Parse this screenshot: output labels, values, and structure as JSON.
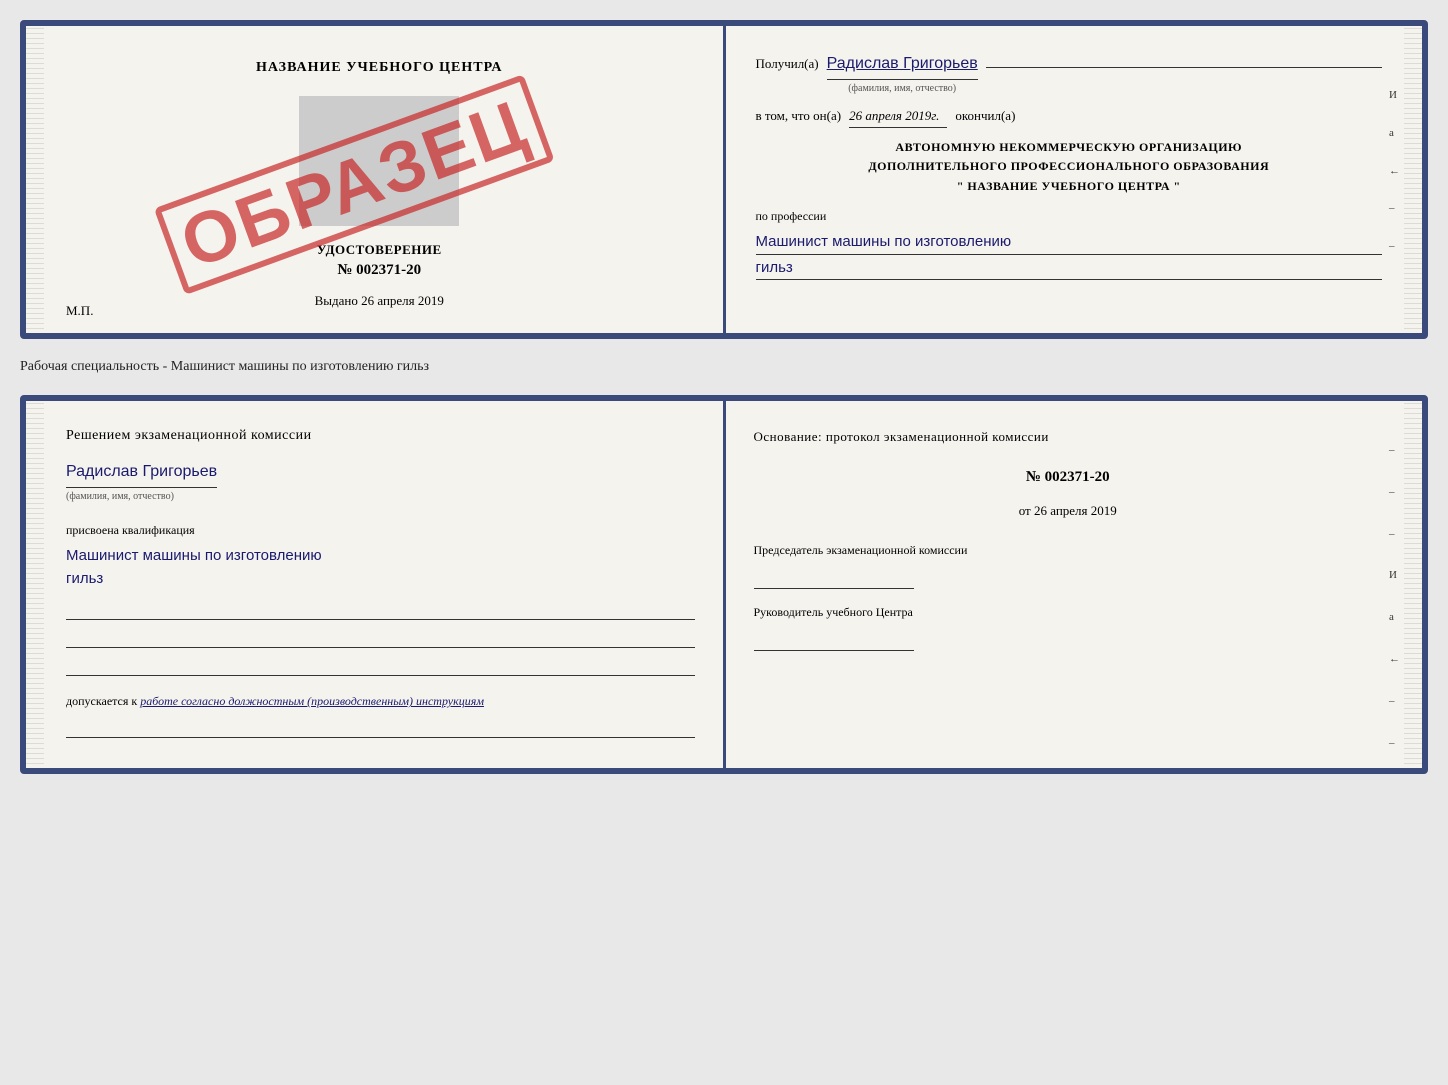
{
  "top_doc": {
    "left": {
      "center_title": "НАЗВАНИЕ УЧЕБНОГО ЦЕНТРА",
      "stamp_placeholder": "",
      "cert_title": "УДОСТОВЕРЕНИЕ",
      "cert_number": "№ 002371-20",
      "cert_date_label": "Выдано",
      "cert_date": "26 апреля 2019",
      "mp_label": "М.П.",
      "obrazets": "ОБРАЗЕЦ"
    },
    "right": {
      "received_label": "Получил(а)",
      "recipient_name": "Радислав Григорьев",
      "fio_sublabel": "(фамилия, имя, отчество)",
      "completed_label": "окончил(а)",
      "in_that_label": "в том, что он(а)",
      "date_value": "26 апреля 2019г.",
      "org_line1": "АВТОНОМНУЮ НЕКОММЕРЧЕСКУЮ ОРГАНИЗАЦИЮ",
      "org_line2": "ДОПОЛНИТЕЛЬНОГО ПРОФЕССИОНАЛЬНОГО ОБРАЗОВАНИЯ",
      "org_name": "\" НАЗВАНИЕ УЧЕБНОГО ЦЕНТРА \"",
      "profession_label": "по профессии",
      "profession_name": "Машинист машины по изготовлению",
      "profession_name2": "гильз",
      "side_marks": [
        "И",
        "а",
        "←",
        "–",
        "–"
      ]
    }
  },
  "between_label": "Рабочая специальность - Машинист машины по изготовлению гильз",
  "bottom_doc": {
    "left": {
      "decision_title": "Решением  экзаменационной  комиссии",
      "person_name": "Радислав Григорьев",
      "fio_sublabel": "(фамилия, имя, отчество)",
      "assigned_label": "присвоена квалификация",
      "qualification_name": "Машинист  машины  по  изготовлению",
      "qualification_name2": "гильз",
      "допуск_label": "допускается к",
      "допуск_text": "работе согласно должностным (производственным) инструкциям"
    },
    "right": {
      "osnov_title": "Основание:  протокол  экзаменационной  комиссии",
      "protocol_number": "№  002371-20",
      "date_prefix": "от",
      "protocol_date": "26 апреля 2019",
      "chairman_title": "Председатель экзаменационной комиссии",
      "manager_title": "Руководитель учебного Центра",
      "side_marks": [
        "–",
        "–",
        "–",
        "И",
        "а",
        "←",
        "–",
        "–",
        "–",
        "–"
      ]
    }
  }
}
